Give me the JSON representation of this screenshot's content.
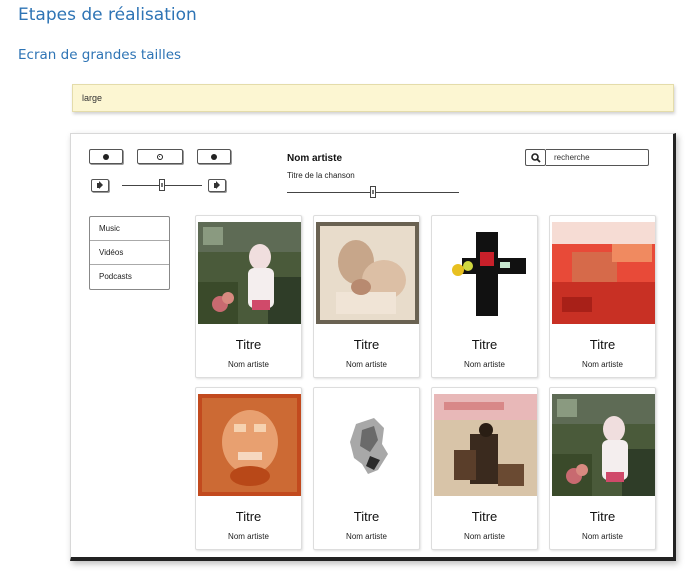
{
  "document": {
    "title": "Etapes de réalisation",
    "subtitle": "Ecran de grandes tailles"
  },
  "banner": {
    "label": "large"
  },
  "player": {
    "artist_name": "Nom artiste",
    "song_title": "Titre de la chanson",
    "controls": [
      "previous-icon",
      "play-icon",
      "next-icon"
    ],
    "volume_level": 0.5,
    "progress_level": 0.5
  },
  "search": {
    "value": "recherche",
    "icon": "search-icon"
  },
  "nav": {
    "items": [
      "Music",
      "Vidéos",
      "Podcasts"
    ]
  },
  "cards": [
    {
      "title": "Titre",
      "artist": "Nom artiste"
    },
    {
      "title": "Titre",
      "artist": "Nom artiste"
    },
    {
      "title": "Titre",
      "artist": "Nom artiste"
    },
    {
      "title": "Titre",
      "artist": "Nom artiste"
    },
    {
      "title": "Titre",
      "artist": "Nom artiste"
    },
    {
      "title": "Titre",
      "artist": "Nom artiste"
    },
    {
      "title": "Titre",
      "artist": "Nom artiste"
    },
    {
      "title": "Titre",
      "artist": "Nom artiste"
    }
  ],
  "colors": {
    "heading": "#2e74b5",
    "banner": "#fcf6d2"
  }
}
